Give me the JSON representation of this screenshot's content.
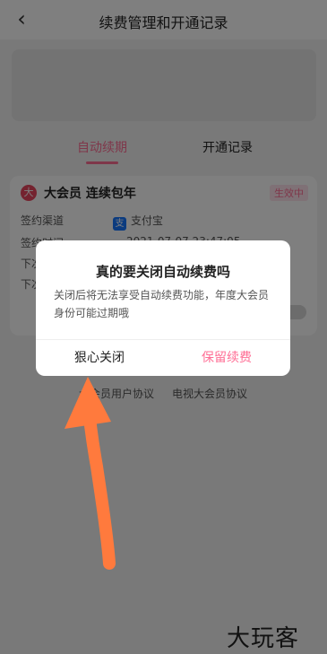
{
  "nav": {
    "back_icon": "chevron-left-icon",
    "title": "续费管理和开通记录"
  },
  "tabs": [
    {
      "label": "自动续期",
      "active": true
    },
    {
      "label": "开通记录",
      "active": false
    }
  ],
  "card": {
    "brand_char": "大",
    "title": "大会员 连续包年",
    "status": "生效中",
    "rows": [
      {
        "label": "签约渠道",
        "value": "支付宝"
      },
      {
        "label": "签约时间",
        "value": "2021-07-07 23:47:05"
      },
      {
        "label": "下次",
        "value": ""
      },
      {
        "label": "下次",
        "value": ""
      }
    ]
  },
  "agreements": {
    "first": "大会员用户协议",
    "second": "电视大会员协议"
  },
  "dialog": {
    "title": "真的要关闭自动续费吗",
    "message": "关闭后将无法享受自动续费功能，年度大会员身份可能过期哦",
    "close_label": "狠心关闭",
    "keep_label": "保留续费"
  },
  "watermark": "大玩客",
  "colors": {
    "accent": "#ff6e95",
    "overlay": "rgba(0,0,0,0.5)",
    "arrow": "#ff7a3d"
  }
}
